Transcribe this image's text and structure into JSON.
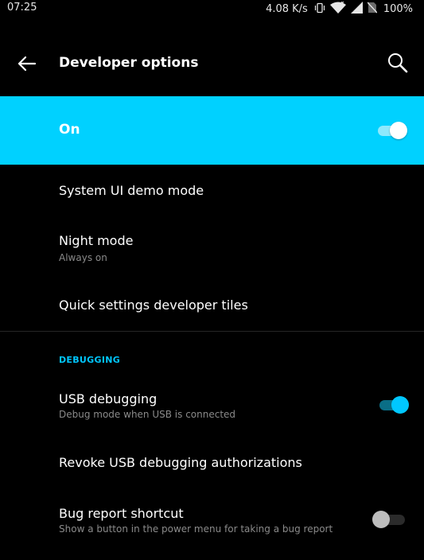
{
  "status_bar": {
    "time": "07:25",
    "speed": "4.08 K/s",
    "icons": [
      "vibrate-icon",
      "wifi-icon",
      "signal-icon",
      "no-sim-icon"
    ],
    "battery": "100%"
  },
  "app_bar": {
    "title": "Developer options",
    "back_icon": "arrow-left-icon",
    "search_icon": "search-icon"
  },
  "master": {
    "label": "On",
    "checked": true,
    "accent": "#00d1ff"
  },
  "items": [
    {
      "title": "System UI demo mode"
    },
    {
      "title": "Night mode",
      "subtitle": "Always on"
    },
    {
      "title": "Quick settings developer tiles"
    }
  ],
  "debugging": {
    "header": "DEBUGGING",
    "items": [
      {
        "title": "USB debugging",
        "subtitle": "Debug mode when USB is connected",
        "checked": true
      },
      {
        "title": "Revoke USB debugging authorizations"
      },
      {
        "title": "Bug report shortcut",
        "subtitle": "Show a button in the power menu for taking a bug report",
        "checked": false
      }
    ]
  }
}
